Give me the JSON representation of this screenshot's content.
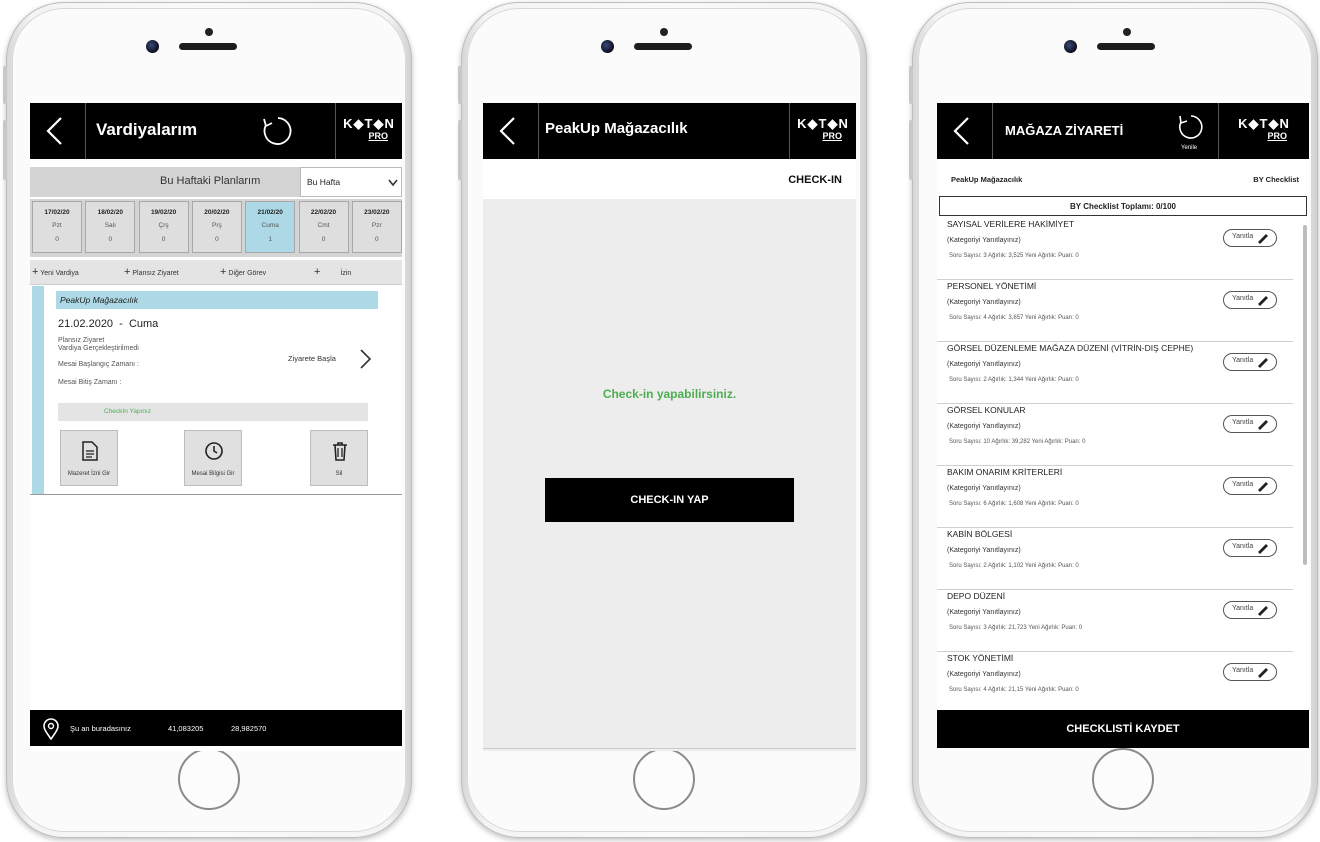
{
  "colors": {
    "accent_light_blue": "#add8e6",
    "success_green": "#4caf50",
    "black": "#000000",
    "checkin_bg": "#ededed"
  },
  "screen1": {
    "title": "Vardiyalarım",
    "logo_top": "K◆T◆N",
    "logo_bottom": "PRO",
    "plans_label": "Bu Haftaki Planlarım",
    "week_select": "Bu Hafta",
    "days": [
      {
        "date": "17/02/20",
        "day": "Pzt",
        "count": "0",
        "selected": false
      },
      {
        "date": "18/02/20",
        "day": "Salı",
        "count": "0",
        "selected": false
      },
      {
        "date": "19/02/20",
        "day": "Çrş",
        "count": "0",
        "selected": false
      },
      {
        "date": "20/02/20",
        "day": "Prş",
        "count": "0",
        "selected": false
      },
      {
        "date": "21/02/20",
        "day": "Cuma",
        "count": "1",
        "selected": true
      },
      {
        "date": "22/02/20",
        "day": "Cmt",
        "count": "0",
        "selected": false
      },
      {
        "date": "23/02/20",
        "day": "Pzr",
        "count": "0",
        "selected": false
      }
    ],
    "actions": {
      "new_shift": "Yeni Vardiya",
      "unplanned_visit": "Plansız Ziyaret",
      "other_task": "Diğer Görev",
      "leave": "İzin"
    },
    "card": {
      "store": "PeakUp Mağazacılık",
      "date": "21.02.2020",
      "weekday": "Cuma",
      "type": "Plansız Ziyaret",
      "status": "Vardiya Gerçekleştirilmedi",
      "start": "Mesai Başlangıç Zamanı :",
      "end": "Mesai Bitiş Zamanı :",
      "start_visit": "Ziyarete Başla",
      "checkin_hint": "CheckIn Yapınız",
      "btn_excuse": "Mazeret İzni Gir",
      "btn_info": "Mesai Bilgisi Gir",
      "btn_delete": "Sil"
    },
    "gps": {
      "label": "Şu an buradasınız",
      "lat": "41,083205",
      "lon": "28,982570"
    }
  },
  "screen2": {
    "title": "PeakUp Mağazacılık",
    "logo_top": "K◆T◆N",
    "logo_bottom": "PRO",
    "header_label": "CHECK-IN",
    "message": "Check-in yapabilirsiniz.",
    "button": "CHECK-IN YAP"
  },
  "screen3": {
    "title": "MAĞAZA ZİYARETİ",
    "refresh_label": "Yenile",
    "logo_top": "K◆T◆N",
    "logo_bottom": "PRO",
    "store": "PeakUp Mağazacılık",
    "checklist": "BY Checklist",
    "total": "BY Checklist Toplamı: 0/100",
    "answer_label": "Yanıtla",
    "categories": [
      {
        "name": "SAYISAL VERİLERE HAKİMİYET",
        "sub": "(Kategoriyi Yanıtlayınız)",
        "meta": "Soru Sayısı: 3    Ağırlık: 3,525    Yeni Ağırlık:    Puan: 0"
      },
      {
        "name": "PERSONEL YÖNETİMİ",
        "sub": "(Kategoriyi Yanıtlayınız)",
        "meta": "Soru Sayısı: 4    Ağırlık: 3,657    Yeni Ağırlık:    Puan: 0"
      },
      {
        "name": "GÖRSEL DÜZENLEME MAĞAZA DÜZENİ (VİTRİN-DIŞ CEPHE)",
        "sub": "(Kategoriyi Yanıtlayınız)",
        "meta": "Soru Sayısı: 2    Ağırlık: 1,344    Yeni Ağırlık:    Puan: 0"
      },
      {
        "name": "GÖRSEL KONULAR",
        "sub": "(Kategoriyi Yanıtlayınız)",
        "meta": "Soru Sayısı: 10    Ağırlık: 39,282    Yeni Ağırlık:    Puan: 0"
      },
      {
        "name": "BAKIM ONARIM KRİTERLERİ",
        "sub": "(Kategoriyi Yanıtlayınız)",
        "meta": "Soru Sayısı: 6    Ağırlık: 1,608    Yeni Ağırlık:    Puan: 0"
      },
      {
        "name": "KABİN BÖLGESİ",
        "sub": "(Kategoriyi Yanıtlayınız)",
        "meta": "Soru Sayısı: 2    Ağırlık: 1,102    Yeni Ağırlık:    Puan: 0"
      },
      {
        "name": "DEPO DÜZENİ",
        "sub": "(Kategoriyi Yanıtlayınız)",
        "meta": "Soru Sayısı: 3    Ağırlık: 21,723    Yeni Ağırlık:    Puan: 0"
      },
      {
        "name": "STOK YÖNETİMİ",
        "sub": "(Kategoriyi Yanıtlayınız)",
        "meta": "Soru Sayısı: 4    Ağırlık: 21,15    Yeni Ağırlık:    Puan: 0"
      }
    ],
    "save_button": "CHECKLISTİ KAYDET"
  }
}
